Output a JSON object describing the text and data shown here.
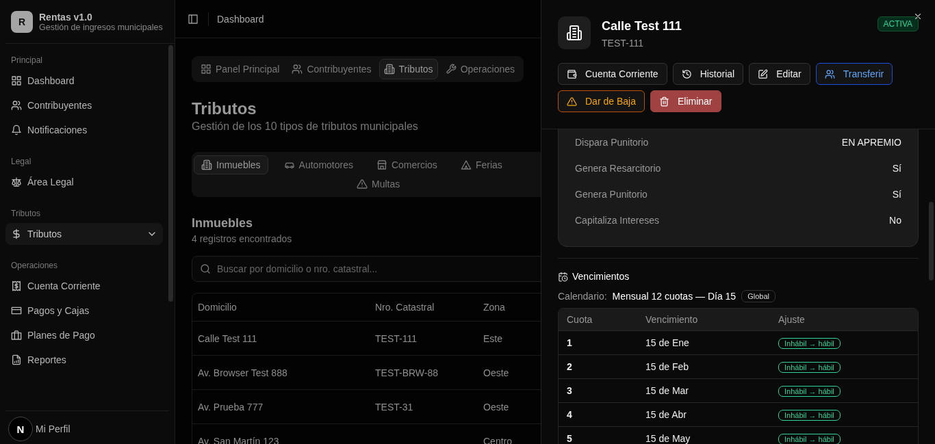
{
  "app": {
    "logo_letter": "R",
    "title": "Rentas v1.0",
    "subtitle": "Gestión de ingresos municipales"
  },
  "sidebar": {
    "groups": [
      {
        "label": "Principal",
        "items": [
          {
            "label": "Dashboard",
            "selected": false
          },
          {
            "label": "Contribuyentes",
            "selected": false
          },
          {
            "label": "Notificaciones",
            "selected": false
          }
        ]
      },
      {
        "label": "Legal",
        "items": [
          {
            "label": "Área Legal",
            "selected": false
          }
        ]
      },
      {
        "label": "Tributos",
        "items": [
          {
            "label": "Tributos",
            "selected": true
          }
        ]
      },
      {
        "label": "Operaciones",
        "items": [
          {
            "label": "Cuenta Corriente",
            "selected": false
          },
          {
            "label": "Pagos y Cajas",
            "selected": false
          },
          {
            "label": "Planes de Pago",
            "selected": false
          },
          {
            "label": "Reportes",
            "selected": false
          }
        ]
      }
    ],
    "footer_item": "Mi Perfil"
  },
  "dev_badge": "N",
  "topbar": {
    "breadcrumb": "Dashboard"
  },
  "nav_tabs": [
    {
      "label": "Panel Principal",
      "selected": false
    },
    {
      "label": "Contribuyentes",
      "selected": false
    },
    {
      "label": "Tributos",
      "selected": true
    },
    {
      "label": "Operaciones",
      "selected": false
    }
  ],
  "page": {
    "title": "Tributos",
    "subtitle": "Gestión de los 10 tipos de tributos municipales"
  },
  "type_tab_rows": [
    [
      {
        "label": "Inmuebles",
        "selected": true
      },
      {
        "label": "Automotores",
        "selected": false
      },
      {
        "label": "Comercios",
        "selected": false
      },
      {
        "label": "Ferias",
        "selected": false
      }
    ],
    [
      {
        "label": "Multas",
        "selected": false
      }
    ]
  ],
  "section": {
    "title": "Inmuebles",
    "count": "4 registros encontrados"
  },
  "search": {
    "placeholder": "Buscar por domicilio o nro. catastral..."
  },
  "table": {
    "columns": [
      "Domicilio",
      "Nro. Catastral",
      "Zona"
    ],
    "rows": [
      [
        "Calle Test 111",
        "TEST-111",
        "Este"
      ],
      [
        "Av. Browser Test 888",
        "TEST-BRW-88",
        "Oeste"
      ],
      [
        "Av. Prueba 777",
        "TEST-31",
        "Oeste"
      ],
      [
        "Av. San Martín 123",
        "",
        "Centro"
      ]
    ]
  },
  "drawer": {
    "title": "Calle Test 111",
    "code": "TEST-111",
    "status": "ACTIVA",
    "actions": [
      [
        {
          "label": "Cuenta Corriente",
          "kind": "default"
        },
        {
          "label": "Historial",
          "kind": "default"
        },
        {
          "label": "Editar",
          "kind": "default"
        },
        {
          "label": "Transferir",
          "kind": "primary"
        }
      ],
      [
        {
          "label": "Dar de Baja",
          "kind": "warning"
        },
        {
          "label": "Eliminar",
          "kind": "danger"
        }
      ]
    ],
    "properties": [
      {
        "label": "Dispara Punitorio",
        "value": "EN APREMIO"
      },
      {
        "label": "Genera Resarcitorio",
        "value": "Sí"
      },
      {
        "label": "Genera Punitorio",
        "value": "Sí"
      },
      {
        "label": "Capitaliza Intereses",
        "value": "No"
      }
    ],
    "schedule": {
      "title": "Vencimientos",
      "calendar_label": "Calendario:",
      "calendar_value": "Mensual 12 cuotas — Día 15",
      "scope": "Global",
      "columns": [
        "Cuota",
        "Vencimiento",
        "Ajuste"
      ],
      "rows": [
        {
          "cuota": "1",
          "date": "15 de Ene",
          "adjust": "Inhábil → hábil"
        },
        {
          "cuota": "2",
          "date": "15 de Feb",
          "adjust": "Inhábil → hábil"
        },
        {
          "cuota": "3",
          "date": "15 de Mar",
          "adjust": "Inhábil → hábil"
        },
        {
          "cuota": "4",
          "date": "15 de Abr",
          "adjust": "Inhábil → hábil"
        },
        {
          "cuota": "5",
          "date": "15 de May",
          "adjust": "Inhábil → hábil"
        }
      ]
    }
  }
}
